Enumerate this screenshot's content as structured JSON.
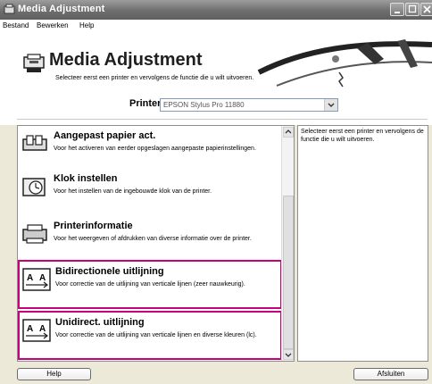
{
  "window": {
    "title": "Media Adjustment"
  },
  "menu": [
    "Bestand",
    "Bewerken",
    "Help"
  ],
  "header": {
    "title": "Media Adjustment",
    "subtitle": "Selecteer eerst een printer en vervolgens de functie die u wilt uitvoeren.",
    "printer_label": "Printer",
    "printer_value": "EPSON Stylus Pro 11880"
  },
  "items": [
    {
      "title": "Aangepast papier act.",
      "desc": "Voor het activeren van eerder opgeslagen aangepaste papierinstellingen.",
      "highlighted": false
    },
    {
      "title": "Klok instellen",
      "desc": "Voor het instellen van de ingebouwde klok van de printer.",
      "highlighted": false
    },
    {
      "title": "Printerinformatie",
      "desc": "Voor het weergeven of afdrukken van diverse informatie over de printer.",
      "highlighted": false
    },
    {
      "title": "Bidirectionele uitlijning",
      "desc": "Voor correctie van de uitlijning van verticale lijnen (zeer nauwkeurig).",
      "highlighted": true
    },
    {
      "title": "Unidirect. uitlijning",
      "desc": "Voor correctie van de uitlijning van verticale lijnen en diverse kleuren (lc).",
      "highlighted": true
    }
  ],
  "info_text": "Selecteer eerst een printer en vervolgens de functie die u wilt uitvoeren.",
  "buttons": {
    "help": "Help",
    "close": "Afsluiten"
  },
  "colors": {
    "highlight": "#c8007a",
    "titlebar": "#6e6e6e"
  },
  "icons": [
    "paper-icon",
    "clock-icon",
    "printer-icon",
    "alignment-icon"
  ]
}
